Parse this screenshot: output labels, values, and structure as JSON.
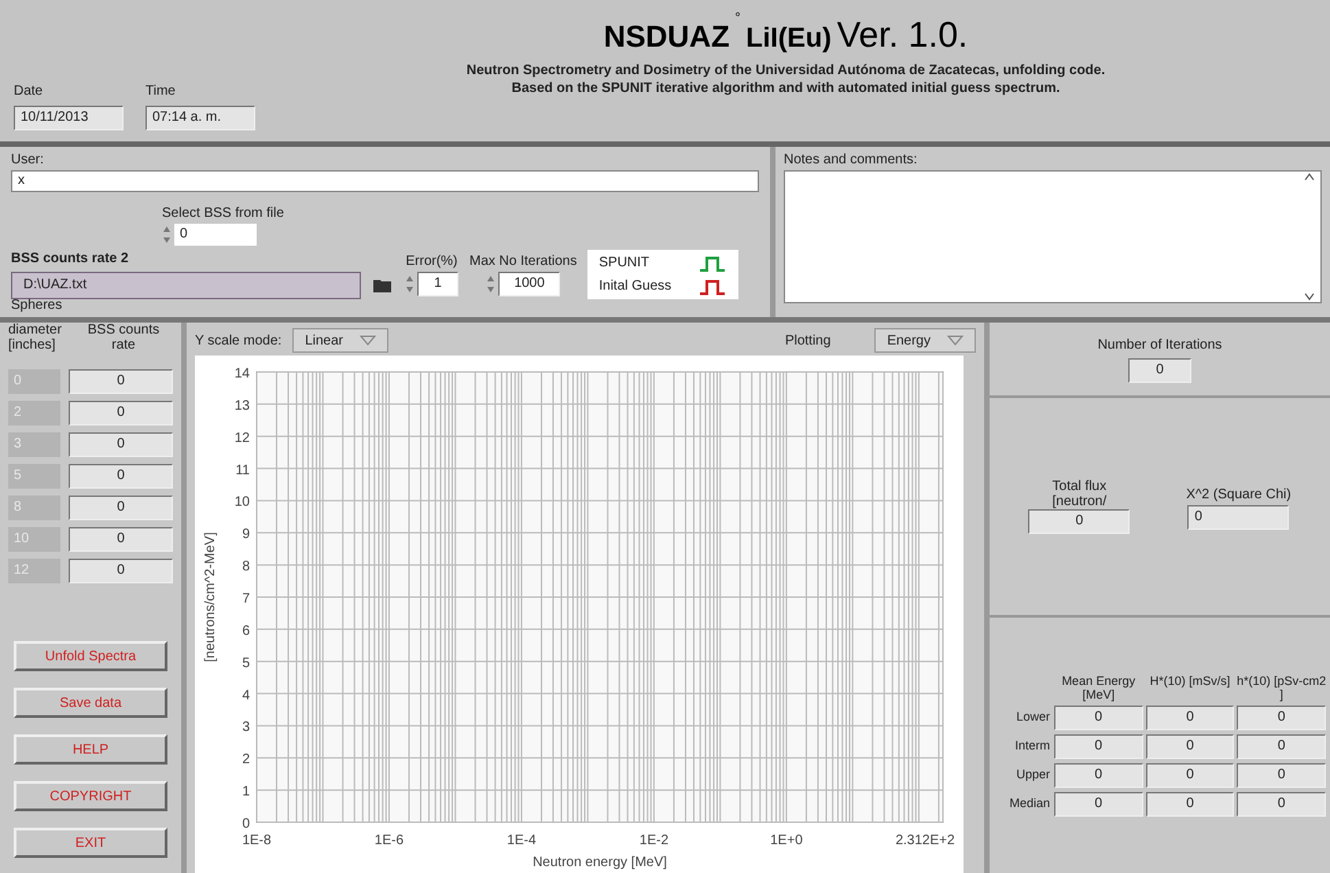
{
  "header": {
    "title": "NSDUAZ",
    "title_mark": "°",
    "title_sub": "LiI(Eu)",
    "version": "Ver. 1.0.",
    "subtitle_lines": [
      "Neutron Spectrometry and Dosimetry of the Universidad Autónoma de Zacatecas, unfolding code.",
      "Based on the SPUNIT iterative algorithm and with automated initial guess spectrum."
    ],
    "date": {
      "label": "Date",
      "value": "10/11/2013"
    },
    "time": {
      "label": "Time",
      "value": "07:14 a. m."
    }
  },
  "user": {
    "label": "User:",
    "value": "x"
  },
  "notes": {
    "label": "Notes and comments:"
  },
  "bss_file": {
    "select_label": "Select BSS from file",
    "select_value": "0",
    "label": "BSS counts rate 2",
    "path": "D:\\UAZ.txt"
  },
  "error": {
    "label": "Error(%)",
    "value": "1"
  },
  "max_iterations": {
    "label": "Max No Iterations",
    "value": "1000"
  },
  "legend": [
    {
      "name": "SPUNIT",
      "color": "#20a040"
    },
    {
      "name": "Inital Guess",
      "color": "#d02020"
    }
  ],
  "spheres": {
    "label_top": "Spheres",
    "diameter_label": "diameter [inches]",
    "rate_label": "BSS counts rate",
    "rows": [
      {
        "diameter": "0",
        "rate": "0"
      },
      {
        "diameter": "2",
        "rate": "0"
      },
      {
        "diameter": "3",
        "rate": "0"
      },
      {
        "diameter": "5",
        "rate": "0"
      },
      {
        "diameter": "8",
        "rate": "0"
      },
      {
        "diameter": "10",
        "rate": "0"
      },
      {
        "diameter": "12",
        "rate": "0"
      }
    ]
  },
  "actions": [
    "Unfold Spectra",
    "Save data",
    "HELP",
    "COPYRIGHT",
    "EXIT"
  ],
  "plot": {
    "y_scale_label": "Y scale mode:",
    "y_scale_value": "Linear",
    "plotting_label": "Plotting",
    "plotting_value": "Energy",
    "chart_data": {
      "type": "line",
      "xlabel": "Neutron energy [MeV]",
      "ylabel": "[neutrons/cm^2-MeV]",
      "categories": [
        "1E-8",
        "1E-6",
        "1E-4",
        "1E-2",
        "1E+0",
        "2.312E+2"
      ],
      "ylim": [
        0,
        14
      ],
      "grid": true,
      "yticks": [
        0,
        1,
        2,
        3,
        4,
        5,
        6,
        7,
        8,
        9,
        10,
        11,
        12,
        13,
        14
      ]
    }
  },
  "iterations": {
    "label": "Number of Iterations",
    "value": "0"
  },
  "total_flux": {
    "label": "Total flux [neutron/",
    "value": "0"
  },
  "chi_square": {
    "label": "X^2 (Square Chi)",
    "value": "0"
  },
  "results": {
    "columns": [
      "Mean Energy [MeV]",
      "H*(10) [mSv/s]",
      "h*(10) [pSv-cm2 ]"
    ],
    "rows": [
      {
        "label": "Lower",
        "values": [
          "0",
          "0",
          "0"
        ]
      },
      {
        "label": "Interm",
        "values": [
          "0",
          "0",
          "0"
        ]
      },
      {
        "label": "Upper",
        "values": [
          "0",
          "0",
          "0"
        ]
      },
      {
        "label": "Median",
        "values": [
          "0",
          "0",
          "0"
        ]
      }
    ]
  }
}
